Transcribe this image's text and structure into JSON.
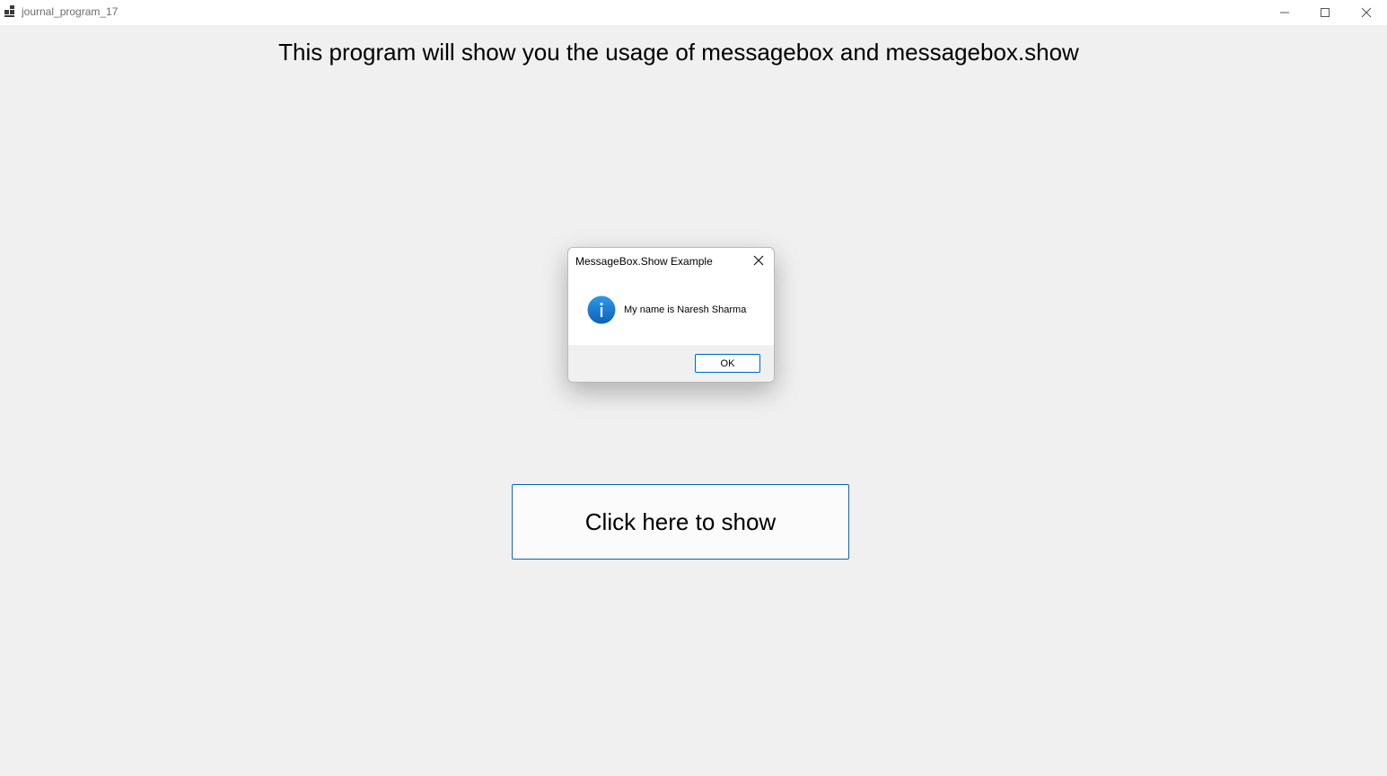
{
  "window": {
    "title": "journal_program_17",
    "controls": {
      "minimize_icon": "minimize-icon",
      "maximize_icon": "maximize-icon",
      "close_icon": "close-icon"
    }
  },
  "main": {
    "heading": "This program will show you the usage of messagebox and messagebox.show",
    "show_button_label": "Click here to show"
  },
  "messagebox": {
    "title": "MessageBox.Show Example",
    "icon": "info-icon",
    "message": "My name is Naresh Sharma",
    "ok_label": "OK"
  },
  "colors": {
    "background": "#f0f0f0",
    "accent": "#0067c0",
    "info_icon": "#1a7fd4"
  }
}
